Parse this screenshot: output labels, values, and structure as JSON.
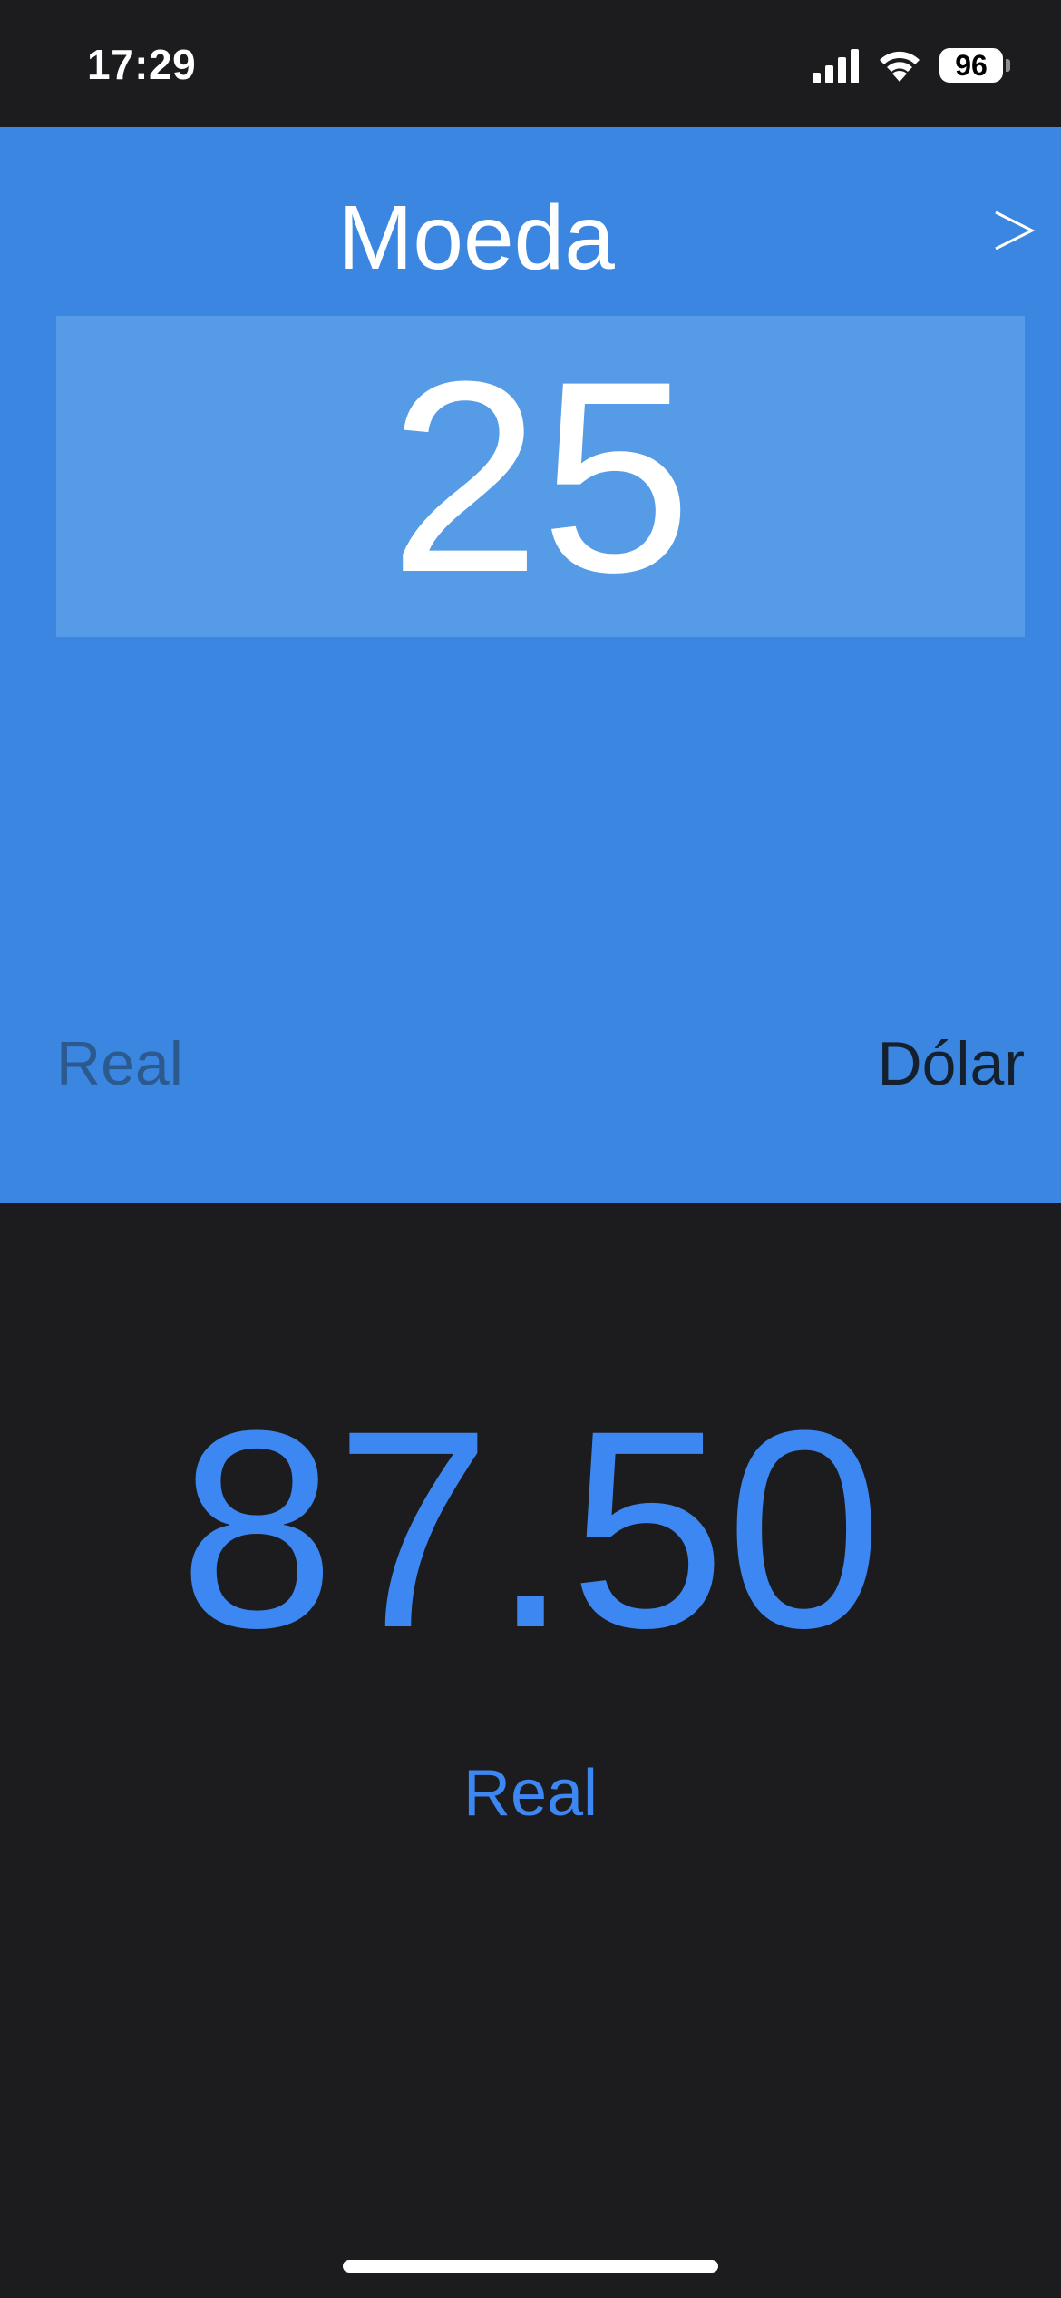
{
  "status_bar": {
    "time": "17:29",
    "battery": "96",
    "icons": [
      "signal-icon",
      "wifi-icon",
      "battery-icon"
    ]
  },
  "input_panel": {
    "title": "Moeda",
    "next_label": ">",
    "value": "25",
    "currency_from": "Real",
    "currency_to": "Dólar"
  },
  "result": {
    "value": "87.50",
    "unit": "Real"
  },
  "colors": {
    "panel_bg": "#3a86e1",
    "input_bg": "#559be6",
    "result_text": "#3d87f2",
    "background": "#1c1c1e"
  }
}
